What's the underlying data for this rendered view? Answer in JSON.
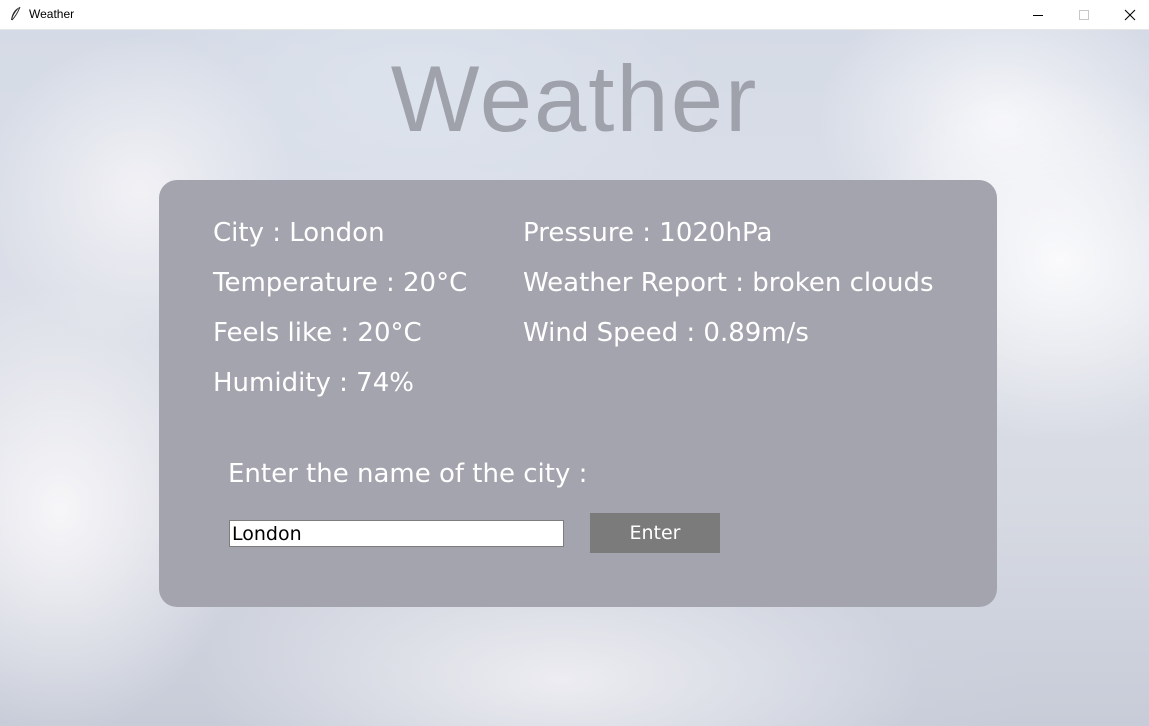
{
  "window": {
    "title": "Weather",
    "icon": "feather-icon",
    "controls": [
      "minimize-icon",
      "maximize-icon",
      "close-icon"
    ]
  },
  "heading": "Weather",
  "weather": {
    "city": "City : London",
    "temperature": "Temperature : 20°C",
    "feels_like": "Feels like : 20°C",
    "humidity": "Humidity : 74%",
    "pressure": "Pressure : 1020hPa",
    "report": "Weather Report : broken clouds",
    "wind_speed": "Wind Speed : 0.89m/s"
  },
  "form": {
    "prompt": "Enter the name of the city :",
    "city_value": "London",
    "button_label": "Enter"
  },
  "colors": {
    "panel": "#a3a4ae",
    "heading": "#9fa1ab",
    "button": "#7b7b7b",
    "text": "#ffffff"
  }
}
